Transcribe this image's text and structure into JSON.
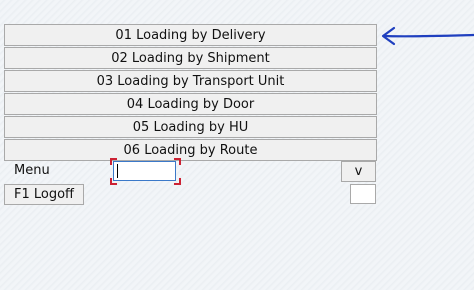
{
  "menu_items": [
    {
      "label": "01 Loading by Delivery"
    },
    {
      "label": "02 Loading by Shipment"
    },
    {
      "label": "03 Loading by Transport Unit"
    },
    {
      "label": "04 Loading by Door"
    },
    {
      "label": "05 Loading by HU"
    },
    {
      "label": "06 Loading by Route"
    }
  ],
  "menu_field": {
    "label": "Menu",
    "value": ""
  },
  "dropdown_button": {
    "label": "v"
  },
  "logoff_button": {
    "label": "F1 Logoff"
  },
  "annotation": {
    "icon": "arrow-left-icon",
    "color": "#1f3fbf"
  },
  "colors": {
    "input_focus_border": "#3b79c9",
    "focus_corners": "#cc2233"
  }
}
